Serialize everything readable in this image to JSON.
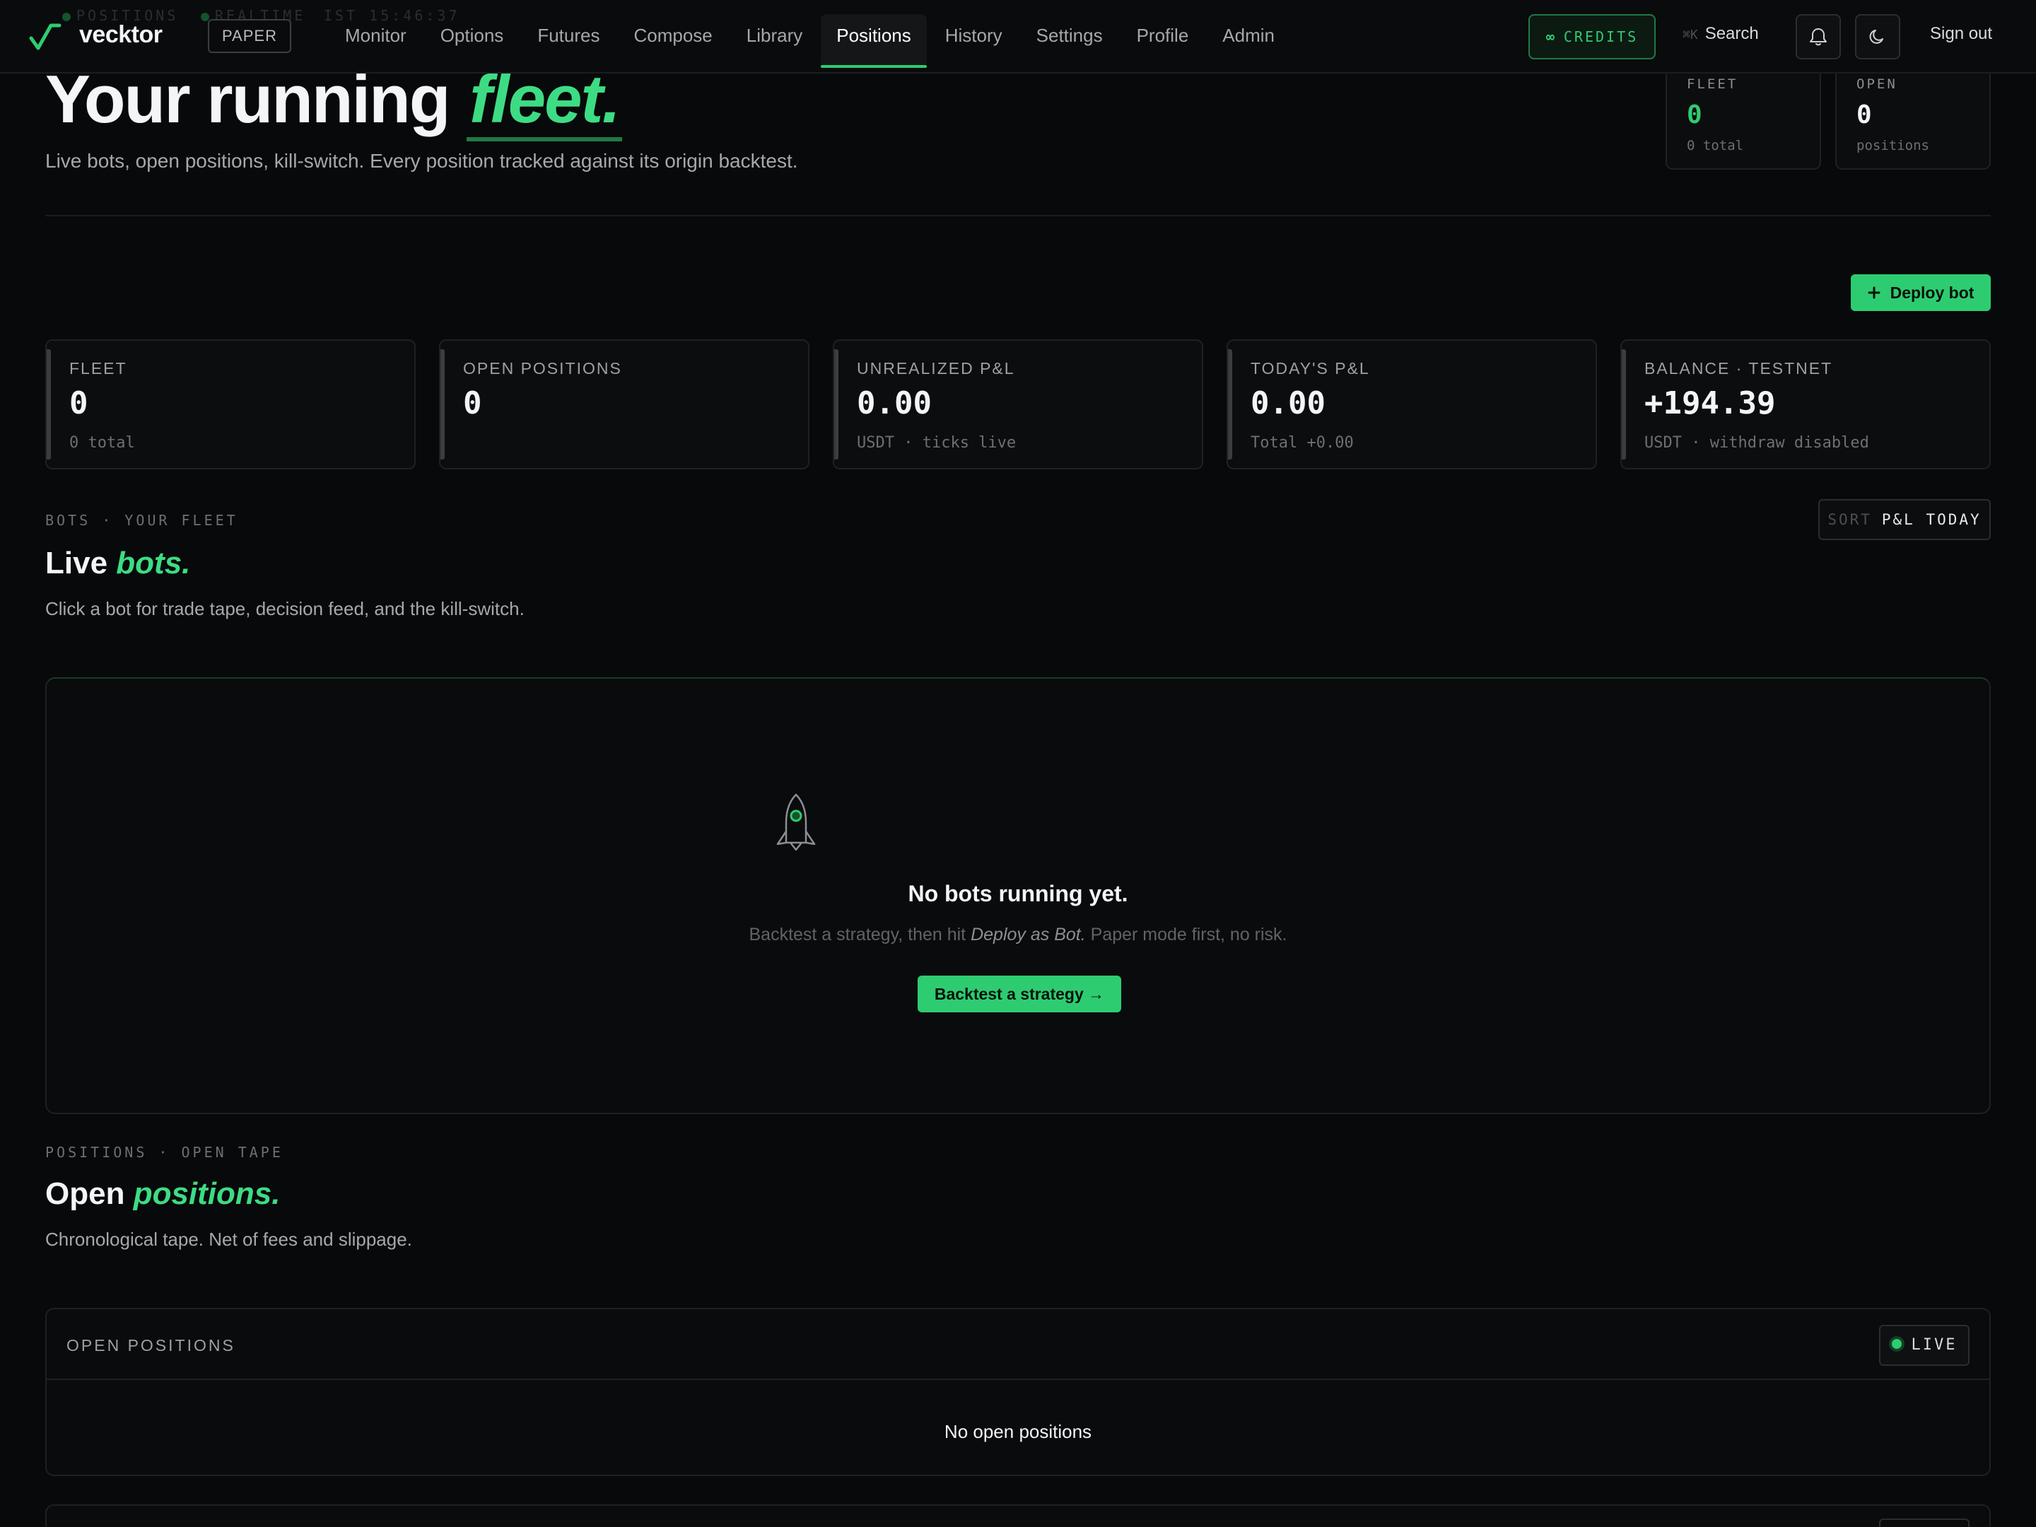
{
  "nav": {
    "ghost_section": "POSITIONS",
    "ghost_status": "REALTIME",
    "ghost_clock": "IST 15:46:37",
    "brand": "vecktor",
    "mode_badge": "PAPER",
    "links": [
      "Monitor",
      "Options",
      "Futures",
      "Compose",
      "Library",
      "Positions",
      "History",
      "Settings",
      "Profile",
      "Admin"
    ],
    "active_link": "Positions",
    "credits_label": "CREDITS",
    "credits_symbol": "∞",
    "search_shortcut": "⌘K",
    "search_label": "Search",
    "signout_label": "Sign out"
  },
  "header": {
    "title_prefix": "Your running",
    "title_emphasis": "fleet.",
    "subtitle": "Live bots, open positions, kill-switch. Every position tracked against its origin backtest.",
    "mini_cards": [
      {
        "label": "FLEET",
        "value": "0",
        "sub": "0 total"
      },
      {
        "label": "OPEN",
        "value": "0",
        "sub": "positions"
      }
    ]
  },
  "deploy_button": "Deploy bot",
  "stats": [
    {
      "label": "FLEET",
      "value": "0",
      "sub": "0 total"
    },
    {
      "label": "OPEN POSITIONS",
      "value": "0",
      "sub": ""
    },
    {
      "label": "UNREALIZED P&L",
      "value": "0.00",
      "sub": "USDT · ticks live"
    },
    {
      "label": "TODAY'S P&L",
      "value": "0.00",
      "sub": "Total +0.00"
    },
    {
      "label": "BALANCE · TESTNET",
      "value": "+194.39",
      "sub": "USDT · withdraw disabled"
    }
  ],
  "bots": {
    "eyebrow": "BOTS · YOUR FLEET",
    "title_prefix": "Live",
    "title_emphasis": "bots.",
    "subtitle": "Click a bot for trade tape, decision feed, and the kill-switch.",
    "sort_key": "SORT",
    "sort_value": "P&L TODAY",
    "empty_title": "No bots running yet.",
    "empty_sub_before": "Backtest a strategy, then hit",
    "empty_sub_italic": "Deploy as Bot.",
    "empty_sub_after": "Paper mode first, no risk.",
    "empty_button": "Backtest a strategy →"
  },
  "positions": {
    "eyebrow": "POSITIONS · OPEN TAPE",
    "title_prefix": "Open",
    "title_emphasis": "positions.",
    "subtitle": "Chronological tape. Net of fees and slippage.",
    "panel_title": "OPEN POSITIONS",
    "live_label": "LIVE",
    "empty_text": "No open positions"
  },
  "colors": {
    "accent": "#2ecc71",
    "background": "#08090a",
    "panel": "#0c0d0e",
    "border": "#1e2123"
  }
}
